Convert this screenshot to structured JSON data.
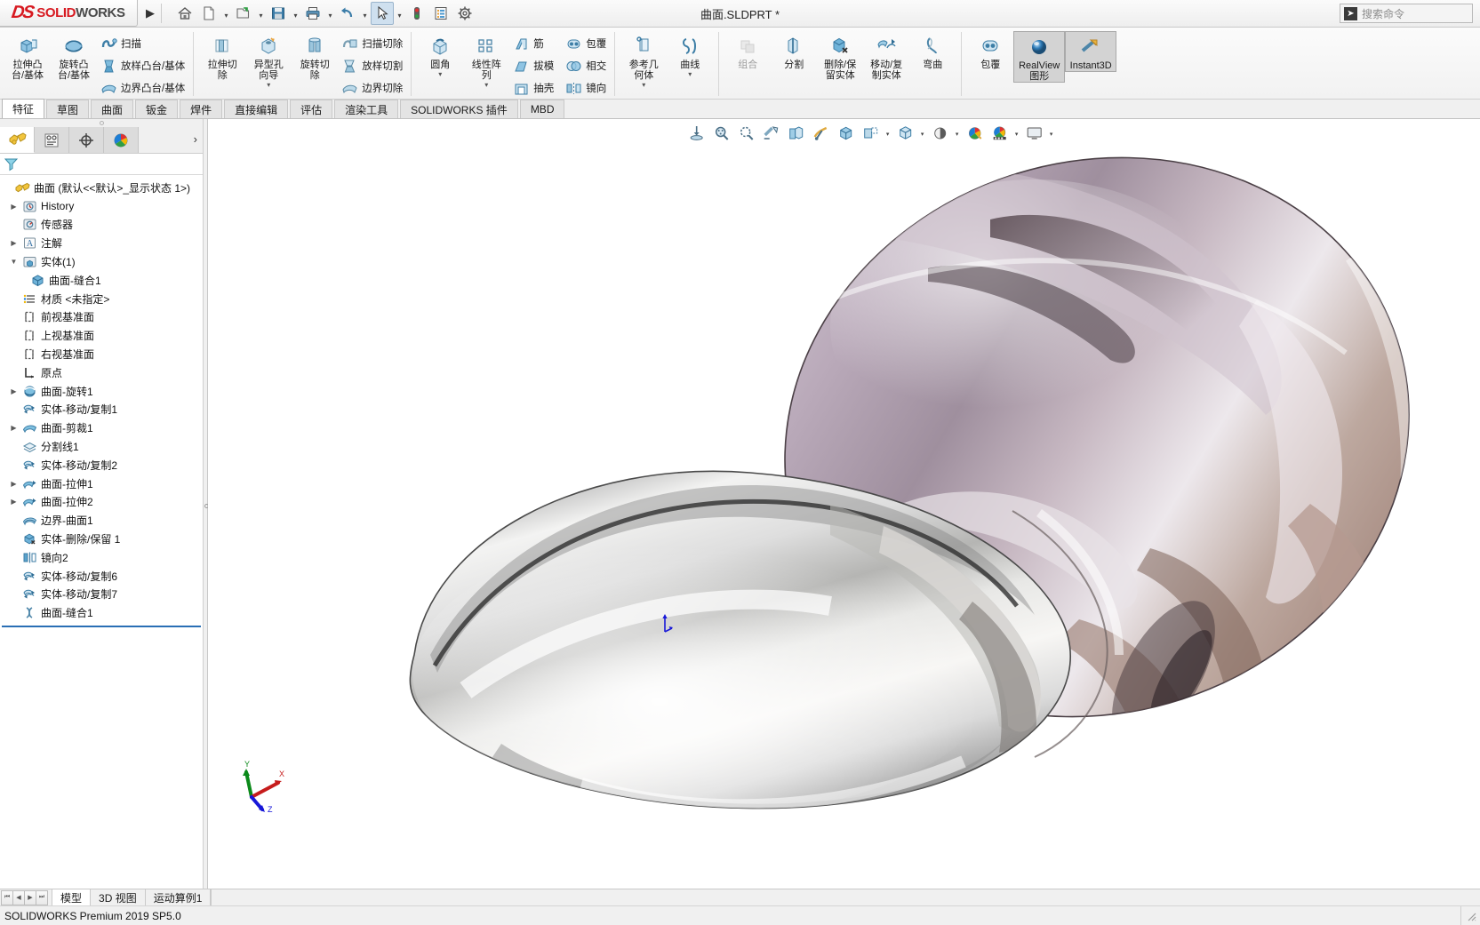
{
  "titlebar": {
    "logo_ds": "DS",
    "logo_sol": "SOLID",
    "logo_wrk": "WORKS",
    "logo_arrow": "▶",
    "document_title": "曲面.SLDPRT *",
    "search_placeholder": "搜索命令",
    "quick_access": [
      {
        "name": "home-icon",
        "glyph": "⌂"
      },
      {
        "name": "new-document-icon",
        "glyph": "🗋"
      },
      {
        "name": "open-document-icon",
        "glyph": "📂"
      },
      {
        "name": "save-icon",
        "glyph": "💾"
      },
      {
        "name": "print-icon",
        "glyph": "🖨"
      },
      {
        "name": "undo-icon",
        "glyph": "↶"
      },
      {
        "name": "select-pointer-icon",
        "glyph": "➤"
      },
      {
        "name": "rebuild-icon",
        "glyph": "🚦"
      },
      {
        "name": "file-properties-icon",
        "glyph": "☷"
      },
      {
        "name": "options-gear-icon",
        "glyph": "⚙"
      }
    ]
  },
  "ribbon": {
    "groups": [
      {
        "name": "features-boss-group",
        "big": [
          {
            "label": "拉伸凸\n台/基体",
            "icon": "extrude-boss-icon",
            "dropdown": false
          },
          {
            "label": "旋转凸\n台/基体",
            "icon": "revolve-boss-icon",
            "dropdown": false
          }
        ],
        "small": [
          {
            "label": "扫描",
            "icon": "sweep-icon"
          },
          {
            "label": "放样凸台/基体",
            "icon": "loft-icon"
          },
          {
            "label": "边界凸台/基体",
            "icon": "boundary-boss-icon"
          }
        ]
      },
      {
        "name": "features-cut-group",
        "big": [
          {
            "label": "拉伸切\n除",
            "icon": "extrude-cut-icon",
            "dropdown": false
          },
          {
            "label": "异型孔\n向导",
            "icon": "hole-wizard-icon",
            "dropdown": true
          },
          {
            "label": "旋转切\n除",
            "icon": "revolve-cut-icon",
            "dropdown": false
          }
        ],
        "small": [
          {
            "label": "扫描切除",
            "icon": "swept-cut-icon"
          },
          {
            "label": "放样切割",
            "icon": "lofted-cut-icon"
          },
          {
            "label": "边界切除",
            "icon": "boundary-cut-icon"
          }
        ]
      },
      {
        "name": "features-modify-group",
        "big": [
          {
            "label": "圆角",
            "icon": "fillet-icon",
            "dropdown": true
          },
          {
            "label": "线性阵\n列",
            "icon": "linear-pattern-icon",
            "dropdown": true
          }
        ],
        "small": [
          {
            "label": "筋",
            "icon": "rib-icon"
          },
          {
            "label": "拔模",
            "icon": "draft-icon"
          },
          {
            "label": "抽壳",
            "icon": "shell-icon"
          }
        ],
        "small2": [
          {
            "label": "包覆",
            "icon": "wrap-icon"
          },
          {
            "label": "相交",
            "icon": "intersect-icon"
          },
          {
            "label": "镜向",
            "icon": "mirror-icon"
          }
        ]
      },
      {
        "name": "reference-geometry-group",
        "big": [
          {
            "label": "参考几\n何体",
            "icon": "reference-geometry-icon",
            "dropdown": true
          },
          {
            "label": "曲线",
            "icon": "curves-icon",
            "dropdown": true
          }
        ],
        "small": []
      },
      {
        "name": "direct-edit-group",
        "big": [
          {
            "label": "组合",
            "icon": "combine-icon",
            "dropdown": false,
            "disabled": true
          },
          {
            "label": "分割",
            "icon": "split-icon",
            "dropdown": false
          },
          {
            "label": "删除/保\n留实体",
            "icon": "delete-keep-body-icon",
            "dropdown": false
          },
          {
            "label": "移动/复\n制实体",
            "icon": "move-copy-body-icon",
            "dropdown": false
          },
          {
            "label": "弯曲",
            "icon": "flex-icon",
            "dropdown": false
          }
        ],
        "small": []
      },
      {
        "name": "display-group",
        "big": [
          {
            "label": "包覆",
            "icon": "wrap2-icon",
            "dropdown": false
          },
          {
            "label": "RealView\n图形",
            "icon": "realview-icon",
            "dropdown": false,
            "selected": true
          },
          {
            "label": "Instant3D",
            "icon": "instant3d-icon",
            "dropdown": false,
            "selected": true
          }
        ],
        "small": []
      }
    ]
  },
  "command_tabs": [
    {
      "label": "特征",
      "active": true
    },
    {
      "label": "草图",
      "active": false
    },
    {
      "label": "曲面",
      "active": false
    },
    {
      "label": "钣金",
      "active": false
    },
    {
      "label": "焊件",
      "active": false
    },
    {
      "label": "直接编辑",
      "active": false
    },
    {
      "label": "评估",
      "active": false
    },
    {
      "label": "渲染工具",
      "active": false
    },
    {
      "label": "SOLIDWORKS 插件",
      "active": false
    },
    {
      "label": "MBD",
      "active": false
    }
  ],
  "left_panel": {
    "tabs": [
      {
        "name": "feature-manager-tab",
        "icon": "feature-tree-icon",
        "active": true
      },
      {
        "name": "property-manager-tab",
        "icon": "property-manager-icon",
        "active": false
      },
      {
        "name": "configuration-manager-tab",
        "icon": "configuration-icon",
        "active": false
      },
      {
        "name": "display-manager-tab",
        "icon": "display-manager-icon",
        "active": false
      }
    ],
    "more_arrow": "›",
    "filter_icon": "filter-icon",
    "tree": [
      {
        "label": "曲面  (默认<<默认>_显示状态 1>)",
        "icon": "part-icon",
        "indent": 0,
        "arrow": "none",
        "root": true
      },
      {
        "label": "History",
        "icon": "history-icon",
        "indent": 1,
        "arrow": "collapsed"
      },
      {
        "label": "传感器",
        "icon": "sensors-icon",
        "indent": 1,
        "arrow": "none"
      },
      {
        "label": "注解",
        "icon": "annotations-icon",
        "indent": 1,
        "arrow": "collapsed"
      },
      {
        "label": "实体(1)",
        "icon": "solid-bodies-icon",
        "indent": 1,
        "arrow": "expanded"
      },
      {
        "label": "曲面-缝合1",
        "icon": "body-icon",
        "indent": 2,
        "arrow": "none"
      },
      {
        "label": "材质 <未指定>",
        "icon": "material-icon",
        "indent": 1,
        "arrow": "none"
      },
      {
        "label": "前视基准面",
        "icon": "plane-icon",
        "indent": 1,
        "arrow": "none"
      },
      {
        "label": "上视基准面",
        "icon": "plane-icon",
        "indent": 1,
        "arrow": "none"
      },
      {
        "label": "右视基准面",
        "icon": "plane-icon",
        "indent": 1,
        "arrow": "none"
      },
      {
        "label": "原点",
        "icon": "origin-icon",
        "indent": 1,
        "arrow": "none"
      },
      {
        "label": "曲面-旋转1",
        "icon": "surface-revolve-icon",
        "indent": 1,
        "arrow": "collapsed"
      },
      {
        "label": "实体-移动/复制1",
        "icon": "move-copy-icon",
        "indent": 1,
        "arrow": "none"
      },
      {
        "label": "曲面-剪裁1",
        "icon": "surface-trim-icon",
        "indent": 1,
        "arrow": "collapsed"
      },
      {
        "label": "分割线1",
        "icon": "split-line-icon",
        "indent": 1,
        "arrow": "none"
      },
      {
        "label": "实体-移动/复制2",
        "icon": "move-copy-icon",
        "indent": 1,
        "arrow": "none"
      },
      {
        "label": "曲面-拉伸1",
        "icon": "surface-extrude-icon",
        "indent": 1,
        "arrow": "collapsed"
      },
      {
        "label": "曲面-拉伸2",
        "icon": "surface-extrude-icon",
        "indent": 1,
        "arrow": "collapsed"
      },
      {
        "label": "边界-曲面1",
        "icon": "boundary-surface-icon",
        "indent": 1,
        "arrow": "none"
      },
      {
        "label": "实体-删除/保留 1",
        "icon": "delete-keep-icon",
        "indent": 1,
        "arrow": "none"
      },
      {
        "label": "镜向2",
        "icon": "mirror-feature-icon",
        "indent": 1,
        "arrow": "none"
      },
      {
        "label": "实体-移动/复制6",
        "icon": "move-copy-icon",
        "indent": 1,
        "arrow": "none"
      },
      {
        "label": "实体-移动/复制7",
        "icon": "move-copy-icon",
        "indent": 1,
        "arrow": "none"
      },
      {
        "label": "曲面-缝合1",
        "icon": "surface-knit-icon",
        "indent": 1,
        "arrow": "none"
      }
    ]
  },
  "heads_up_toolbar": [
    {
      "name": "zoom-to-fit-icon",
      "caret": false
    },
    {
      "name": "zoom-to-area-icon",
      "caret": false
    },
    {
      "name": "previous-view-icon",
      "caret": false
    },
    {
      "name": "section-view-icon",
      "caret": false
    },
    {
      "name": "view-orientation-icon",
      "caret": false
    },
    {
      "name": "view-settings-icon",
      "caret": false
    },
    {
      "name": "display-style-cube-icon",
      "caret": false
    },
    {
      "name": "hide-show-items-icon",
      "caret": true
    },
    {
      "name": "edit-appearance-icon",
      "caret": true
    },
    {
      "name": "apply-scene-icon",
      "caret": true
    },
    {
      "name": "view-setting-2-icon",
      "caret": true
    },
    {
      "name": "scene-icon",
      "caret": false
    },
    {
      "name": "background-icon",
      "caret": true
    },
    {
      "name": "viewport-icon",
      "caret": true
    }
  ],
  "bottom": {
    "nav_buttons": [
      "⏮",
      "◀",
      "▶",
      "⏭"
    ],
    "tabs": [
      {
        "label": "模型",
        "active": true
      },
      {
        "label": "3D 视图",
        "active": false
      },
      {
        "label": "运动算例1",
        "active": false
      }
    ]
  },
  "statusbar": {
    "text": "SOLIDWORKS Premium 2019 SP5.0"
  },
  "colors": {
    "accent_red": "#d71920",
    "tree_select_line": "#2a6fb5",
    "icon_blue": "#4f9bd0",
    "panel_bg": "#f0f0f0",
    "graphics_bg": "#ffffff"
  }
}
